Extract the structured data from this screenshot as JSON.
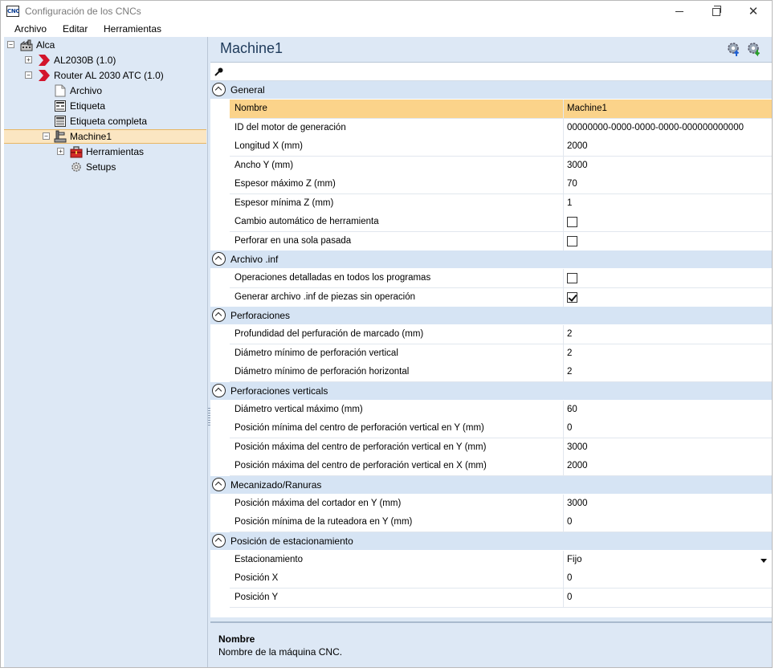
{
  "window": {
    "title": "Configuración de los CNCs",
    "app_icon_text": "CNC"
  },
  "menu": [
    "Archivo",
    "Editar",
    "Herramientas"
  ],
  "tree": {
    "root": "Alca",
    "items": [
      {
        "label": "AL2030B (1.0)",
        "icon": "red-chevron-icon"
      },
      {
        "label": "Router AL 2030 ATC (1.0)",
        "icon": "red-chevron-icon"
      },
      {
        "label": "Archivo",
        "icon": "document-icon"
      },
      {
        "label": "Etiqueta",
        "icon": "label-icon"
      },
      {
        "label": "Etiqueta completa",
        "icon": "label-full-icon"
      },
      {
        "label": "Machine1",
        "icon": "machine-icon"
      },
      {
        "label": "Herramientas",
        "icon": "toolbox-icon"
      },
      {
        "label": "Setups",
        "icon": "gear-icon"
      }
    ]
  },
  "panel": {
    "title": "Machine1"
  },
  "categories": [
    {
      "label": "General",
      "rows": [
        {
          "name": "Nombre",
          "value": "Machine1"
        },
        {
          "name": "ID del motor de generación",
          "value": "00000000-0000-0000-0000-000000000000"
        },
        {
          "name": "Longitud X (mm)",
          "value": "2000"
        },
        {
          "name": "Ancho Y (mm)",
          "value": "3000"
        },
        {
          "name": "Espesor máximo Z (mm)",
          "value": "70"
        },
        {
          "name": "Espesor mínima Z (mm)",
          "value": "1"
        },
        {
          "name": "Cambio automático de herramienta",
          "checked": false
        },
        {
          "name": "Perforar en una sola pasada",
          "checked": false
        }
      ]
    },
    {
      "label": "Archivo .inf",
      "rows": [
        {
          "name": "Operaciones detalladas en todos los programas",
          "checked": false
        },
        {
          "name": "Generar archivo .inf de piezas sin operación",
          "checked": true
        }
      ]
    },
    {
      "label": "Perforaciones",
      "rows": [
        {
          "name": "Profundidad del perfuración de marcado (mm)",
          "value": "2"
        },
        {
          "name": "Diámetro mínimo de perforación vertical",
          "value": "2"
        },
        {
          "name": "Diámetro mínimo de perforación horizontal",
          "value": "2"
        }
      ]
    },
    {
      "label": "Perforaciones verticals",
      "rows": [
        {
          "name": "Diámetro vertical máximo (mm)",
          "value": "60"
        },
        {
          "name": "Posición mínima del centro de perforación vertical en Y (mm)",
          "value": "0"
        },
        {
          "name": "Posición máxima del centro de perforación vertical en Y (mm)",
          "value": "3000"
        },
        {
          "name": "Posición máxima del centro de perforación vertical en X (mm)",
          "value": "2000"
        }
      ]
    },
    {
      "label": "Mecanizado/Ranuras",
      "rows": [
        {
          "name": "Posición máxima del cortador en Y (mm)",
          "value": "3000"
        },
        {
          "name": "Posición mínima de la ruteadora en Y (mm)",
          "value": "0"
        }
      ]
    },
    {
      "label": "Posición de estacionamiento",
      "rows": [
        {
          "name": "Estacionamiento",
          "value": "Fijo"
        },
        {
          "name": "Posición X",
          "value": "0"
        },
        {
          "name": "Posición Y",
          "value": "0"
        }
      ]
    }
  ],
  "description": {
    "title": "Nombre",
    "text": "Nombre de la máquina CNC."
  },
  "colors": {
    "panel_bg": "#dde8f5",
    "selection": "#fbd38a",
    "category_bg": "#d6e4f4"
  }
}
